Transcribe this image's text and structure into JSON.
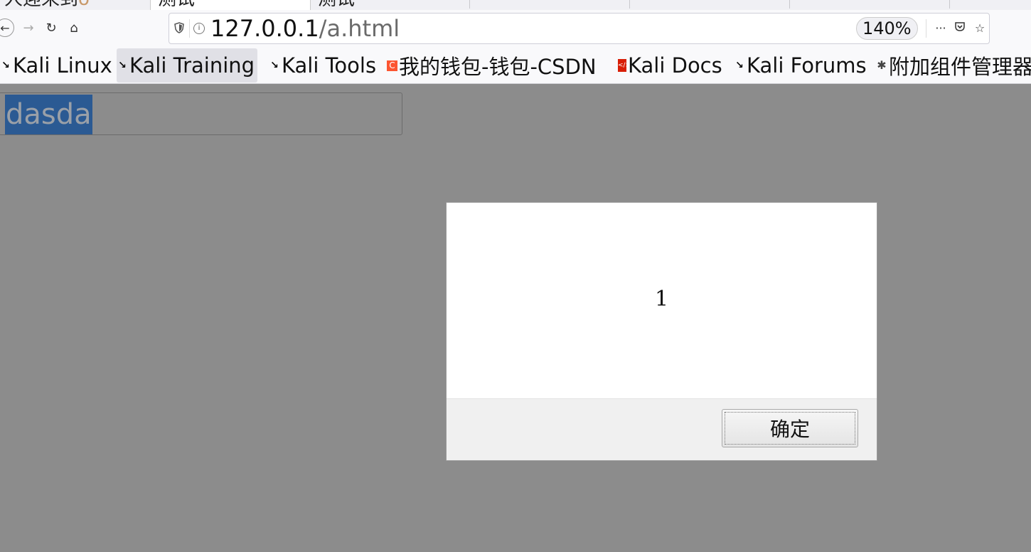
{
  "tabs": [
    {
      "label": "人迎来到",
      "faded_suffix": "o"
    },
    {
      "label": "测试"
    },
    {
      "label": "测试"
    },
    {
      "label": ""
    },
    {
      "label": ""
    },
    {
      "label": ""
    },
    {
      "label": ""
    }
  ],
  "nav": {
    "back_icon": "←",
    "forward_icon": "→",
    "reload_icon": "↻",
    "home_icon": "⌂"
  },
  "urlbar": {
    "host": "127.0.0.1",
    "path": "/a.html",
    "zoom": "140%",
    "more_icon": "···",
    "pocket_icon": "◡",
    "star_icon": "☆"
  },
  "bookmarks": [
    {
      "label": "Kali Linux",
      "icon": "kali-dragon-icon"
    },
    {
      "label": "Kali Training",
      "icon": "kali-dragon-icon"
    },
    {
      "label": "Kali Tools",
      "icon": "kali-dragon-icon"
    },
    {
      "label": "我的钱包-钱包-CSDN",
      "icon": "csdn-icon"
    },
    {
      "label": "Kali Docs",
      "icon": "docs-icon"
    },
    {
      "label": "Kali Forums",
      "icon": "kali-dragon-icon"
    },
    {
      "label": "附加组件管理器",
      "icon": "addon-icon"
    }
  ],
  "page": {
    "input_value": "dasda"
  },
  "alert": {
    "message": "1",
    "ok_label": "确定"
  }
}
